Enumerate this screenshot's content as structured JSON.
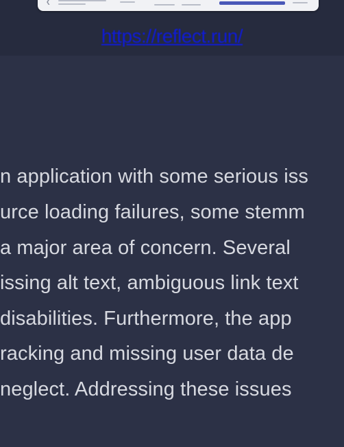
{
  "header": {
    "link_text": "https://reflect.run/"
  },
  "body_text": {
    "lines": [
      "n application with some serious iss",
      "urce loading failures, some stemm",
      "a major area of concern. Several",
      "issing alt text, ambiguous link text",
      " disabilities. Furthermore, the app",
      "racking and missing user data de",
      "neglect. Addressing these issues"
    ]
  },
  "colors": {
    "background": "#2c3146",
    "header_background": "#262b3e",
    "link": "#0f1bd6",
    "text": "#d7d9e0"
  }
}
